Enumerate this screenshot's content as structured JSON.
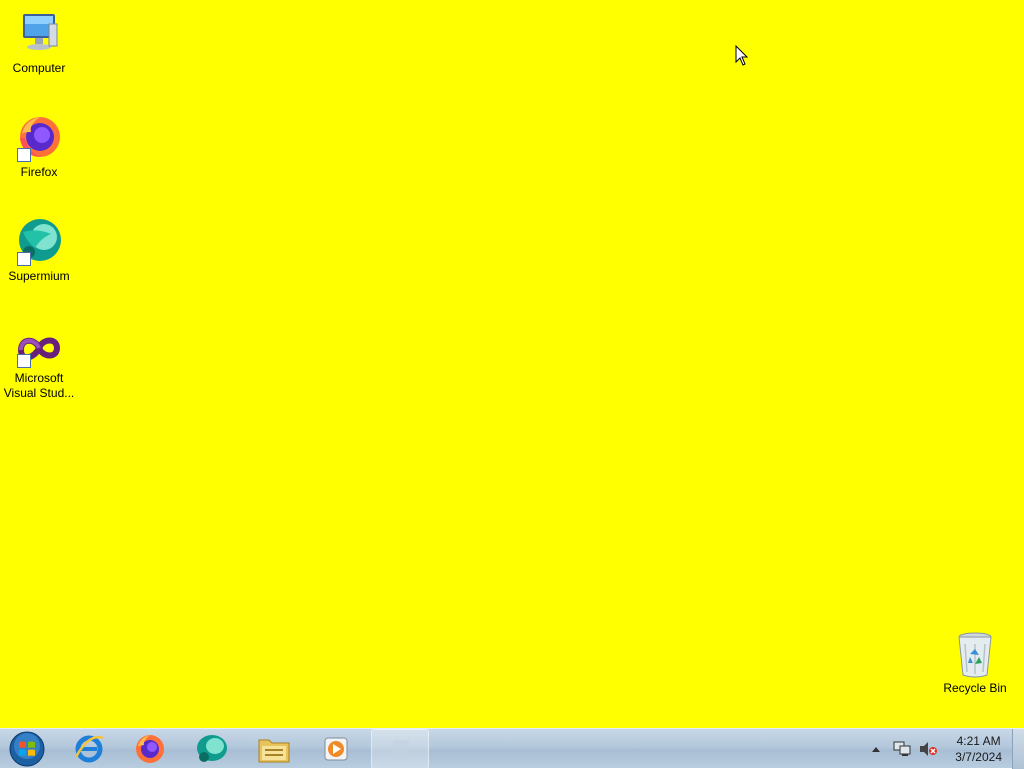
{
  "desktop": {
    "background_color": "#ffff00",
    "icons": [
      {
        "label": "Computer",
        "icon": "computer-icon",
        "shortcut": false
      },
      {
        "label": "Firefox",
        "icon": "firefox-icon",
        "shortcut": true
      },
      {
        "label": "Supermium",
        "icon": "supermium-icon",
        "shortcut": true
      },
      {
        "label": "Microsoft Visual Stud...",
        "icon": "visual-studio-icon",
        "shortcut": true
      },
      {
        "label": "Recycle Bin",
        "icon": "recycle-bin-icon",
        "shortcut": false
      }
    ]
  },
  "taskbar": {
    "start": {
      "icon": "windows-start-orb-icon"
    },
    "pinned": [
      {
        "icon": "internet-explorer-icon"
      },
      {
        "icon": "firefox-icon"
      },
      {
        "icon": "supermium-icon"
      },
      {
        "icon": "file-explorer-icon"
      },
      {
        "icon": "media-player-icon"
      },
      {
        "icon": "blank-app-icon"
      }
    ],
    "tray": {
      "icons": [
        "show-hidden-icons-arrow",
        "network-icon",
        "volume-muted-icon"
      ],
      "time": "4:21 AM",
      "date": "3/7/2024"
    }
  }
}
